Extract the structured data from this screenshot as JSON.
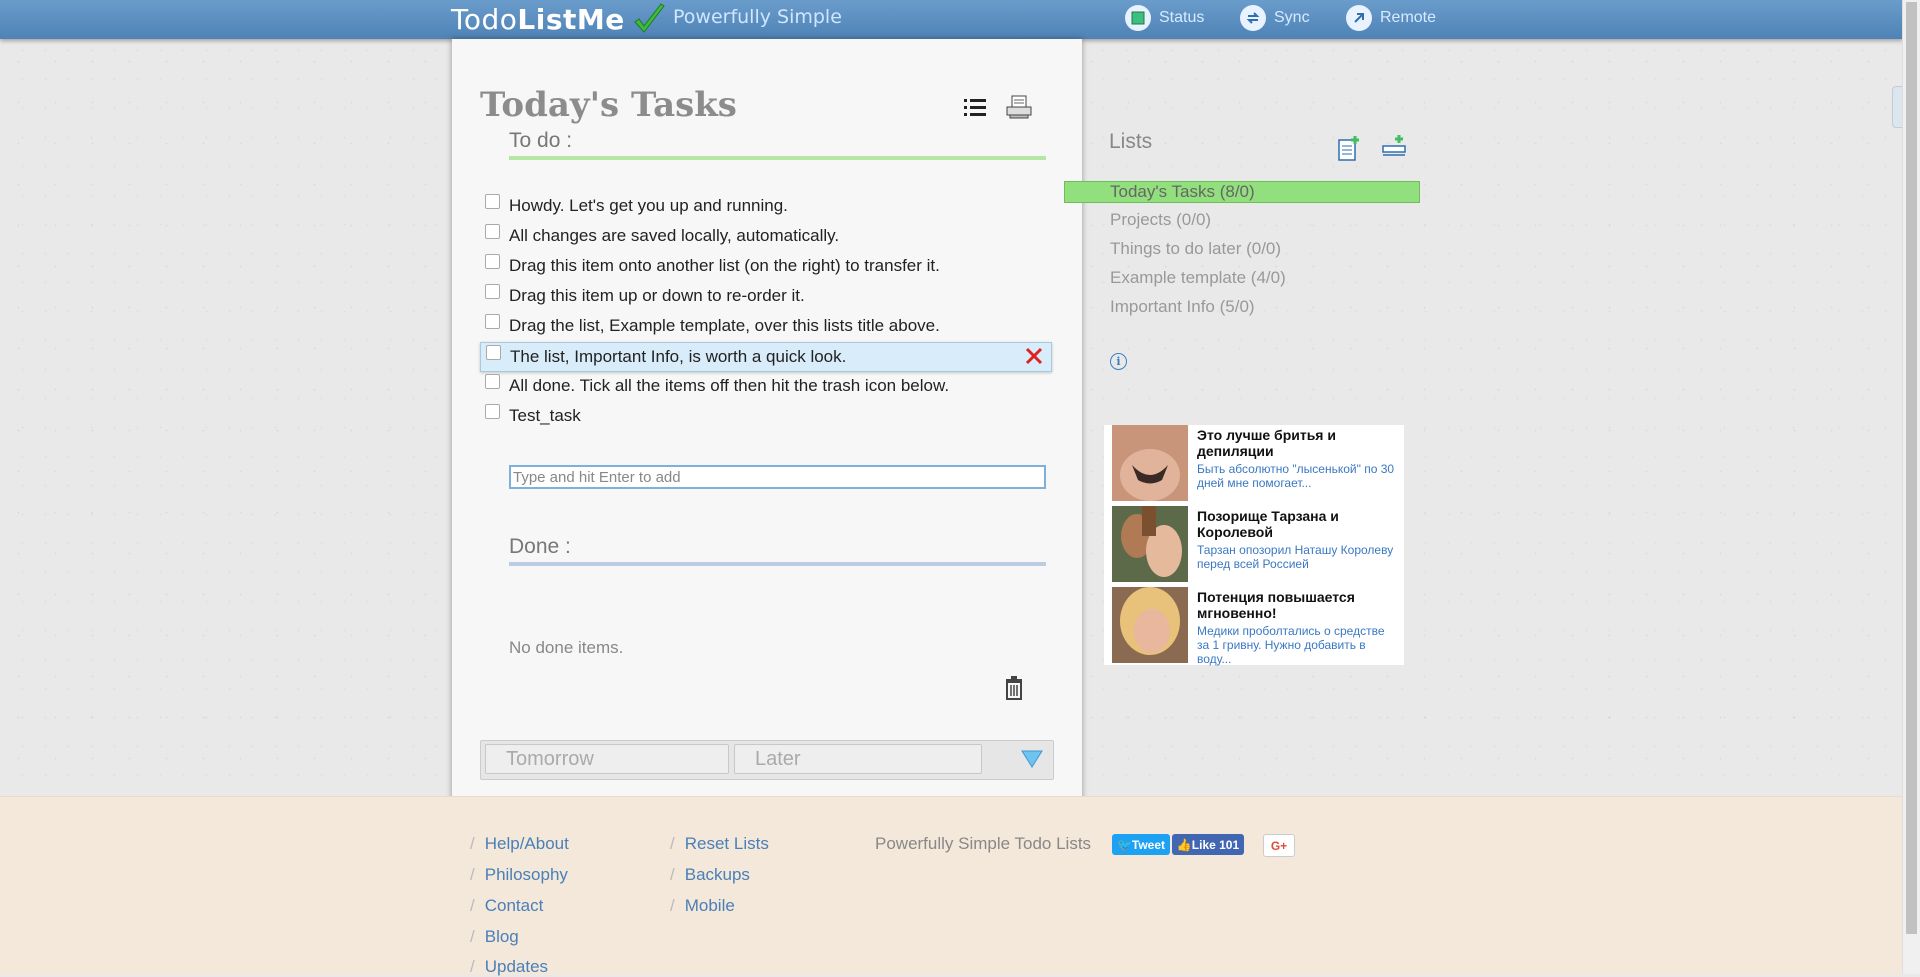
{
  "header": {
    "logo_prefix": "Todo",
    "logo_bold": "ListMe",
    "tagline": "Powerfully Simple",
    "nav": [
      {
        "label": "Status",
        "icon": "status-icon"
      },
      {
        "label": "Sync",
        "icon": "sync-icon"
      },
      {
        "label": "Remote",
        "icon": "remote-icon"
      }
    ]
  },
  "list": {
    "title": "Today's Tasks",
    "todo_heading": "To do :",
    "todo_items": [
      "Howdy. Let's get you up and running.",
      "All changes are saved locally, automatically.",
      "Drag this item onto another list (on the right) to transfer it.",
      "Drag this item up or down to re-order it.",
      "Drag the list, Example template, over this lists title above.",
      "The list, Important Info, is worth a quick look.",
      "All done. Tick all the items off then hit the trash icon below.",
      "Test_task"
    ],
    "add_placeholder": "Type and hit Enter to add",
    "done_heading": "Done :",
    "no_done": "No done items.",
    "bottom_tabs": [
      "Tomorrow",
      "Later"
    ]
  },
  "sidebar": {
    "lists_label": "Lists",
    "lists": [
      "Today's Tasks (8/0)",
      "Projects (0/0)",
      "Things to do later (0/0)",
      "Example template (4/0)",
      "Important Info (5/0)"
    ]
  },
  "ads": [
    {
      "title": "Это лучше бритья и депиляции",
      "desc": "Быть абсолютно \"лысенькой\" по 30 дней мне помогает..."
    },
    {
      "title": "Позорище Тарзана и Королевой",
      "desc": "Тарзан опозорил Наташу Королеву перед всей Россией"
    },
    {
      "title": "Потенция повышается мгновенно!",
      "desc": "Медики проболтались о средстве за 1 гривну. Нужно добавить в воду..."
    }
  ],
  "footer": {
    "col1": [
      "Help/About",
      "Philosophy",
      "Contact",
      "Blog",
      "Updates"
    ],
    "col2": [
      "Reset Lists",
      "Backups",
      "Mobile"
    ],
    "tagline": "Powerfully Simple Todo Lists",
    "tweet": "Tweet",
    "like": "Like 101",
    "gplus": "G+"
  },
  "colors": {
    "header": "#5a8ec0",
    "active_list": "#92e07d",
    "todo_line": "#b6e6a4",
    "done_line": "#b9cee2"
  }
}
